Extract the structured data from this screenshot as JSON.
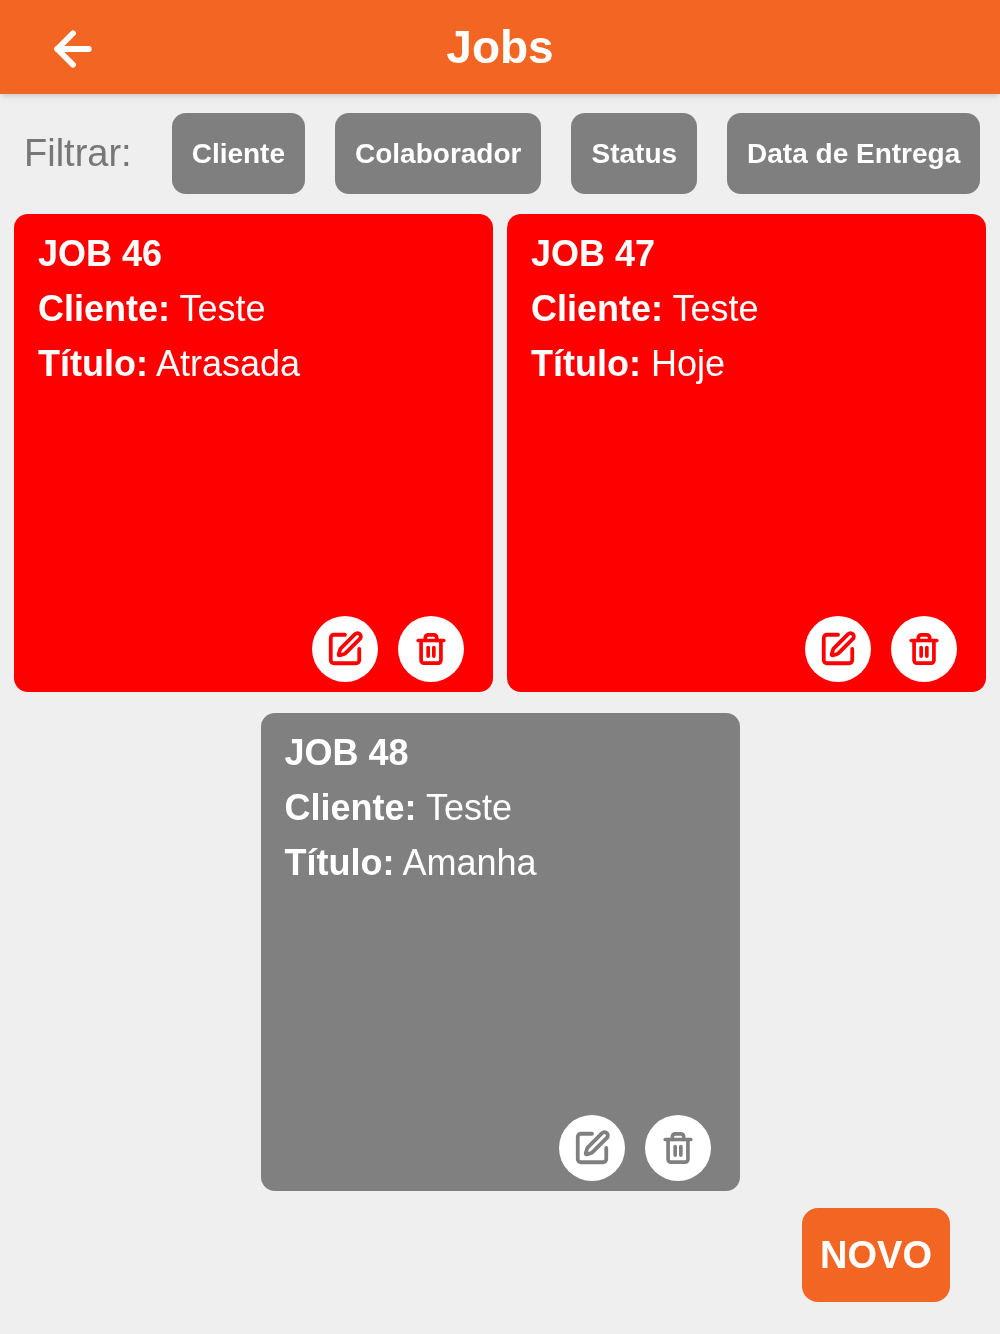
{
  "header": {
    "title": "Jobs"
  },
  "filter": {
    "label": "Filtrar:",
    "buttons": [
      "Cliente",
      "Colaborador",
      "Status",
      "Data de Entrega"
    ]
  },
  "jobs": [
    {
      "title": "JOB 46",
      "fields": [
        {
          "label": "Cliente:",
          "value": "Teste"
        },
        {
          "label": "Título:",
          "value": "Atrasada"
        }
      ],
      "color": "#ff0000"
    },
    {
      "title": "JOB 47",
      "fields": [
        {
          "label": "Cliente:",
          "value": "Teste"
        },
        {
          "label": "Título:",
          "value": "Hoje"
        }
      ],
      "color": "#ff0000"
    },
    {
      "title": "JOB 48",
      "fields": [
        {
          "label": "Cliente:",
          "value": "Teste"
        },
        {
          "label": "Título:",
          "value": "Amanha"
        }
      ],
      "color": "#808080"
    }
  ],
  "new_button": "NOVO"
}
